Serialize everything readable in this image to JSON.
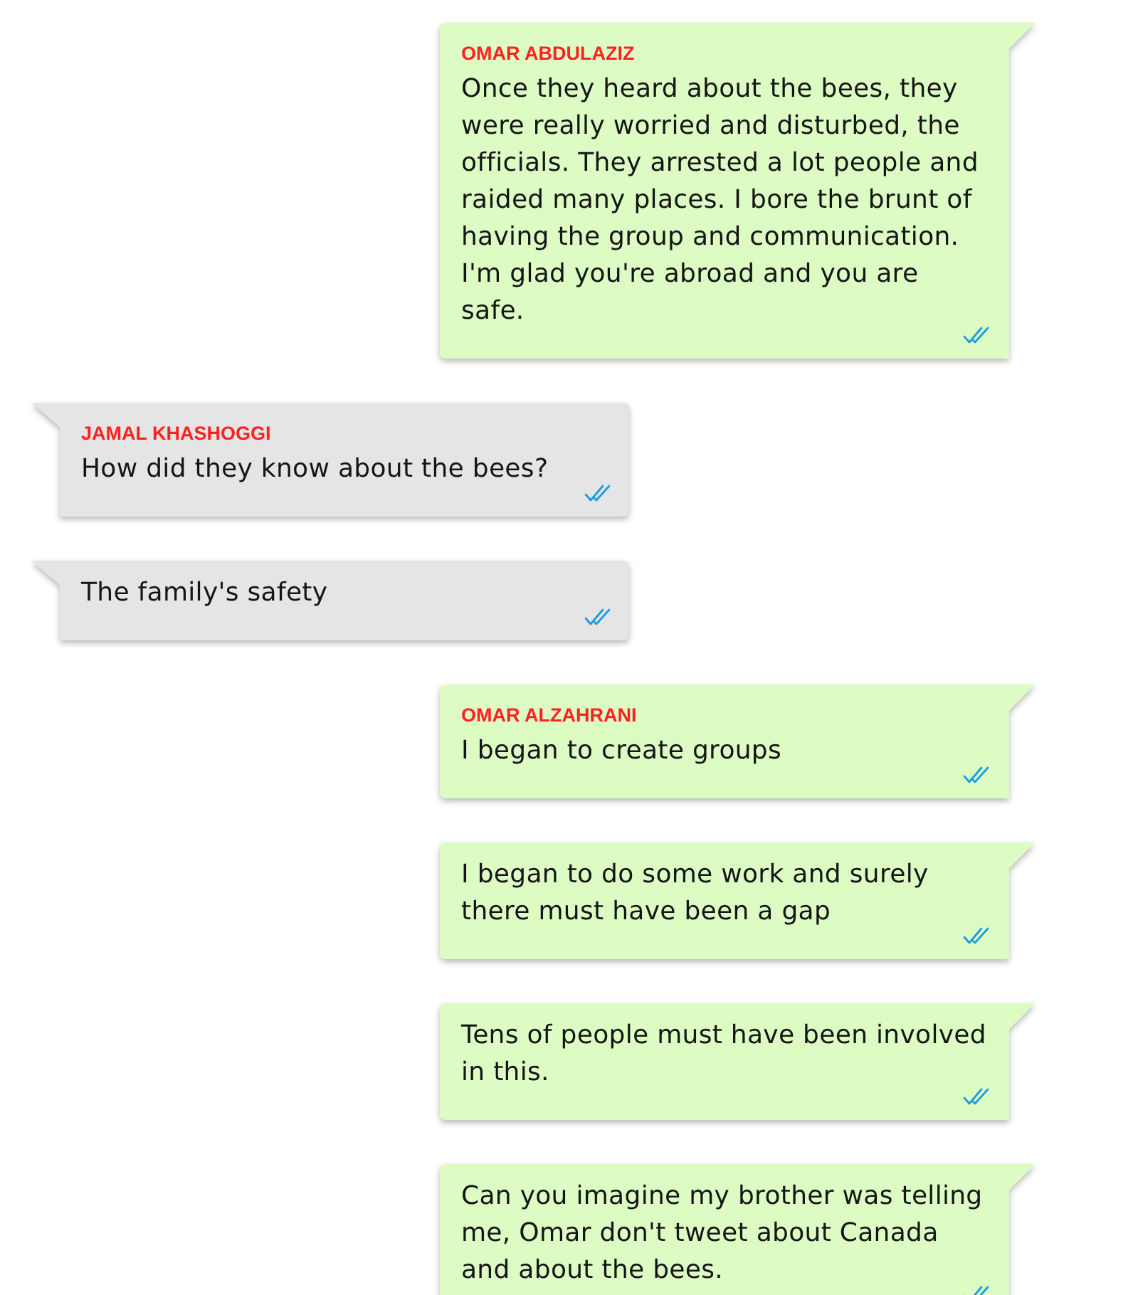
{
  "messages": [
    {
      "kind": "outgoing",
      "sender": "OMAR ABDULAZIZ",
      "text": "Once they heard about the bees, they were really worried and disturbed, the officials. They arrested a lot people and raided many places. I bore the brunt of having the group and communication. I'm glad you're abroad and you are safe."
    },
    {
      "kind": "incoming",
      "sender": "JAMAL KHASHOGGI",
      "text": "How did they know about the bees?"
    },
    {
      "kind": "incoming",
      "text": "The family's safety"
    },
    {
      "kind": "outgoing",
      "sender": "OMAR ALZAHRANI",
      "text": "I began to create groups"
    },
    {
      "kind": "outgoing",
      "text": "I began to do some work and surely there must have been a gap"
    },
    {
      "kind": "outgoing",
      "text": "Tens of people must have been involved in this."
    },
    {
      "kind": "outgoing",
      "text": "Can you imagine my brother was telling me, Omar don't tweet about Canada and about the bees."
    }
  ]
}
